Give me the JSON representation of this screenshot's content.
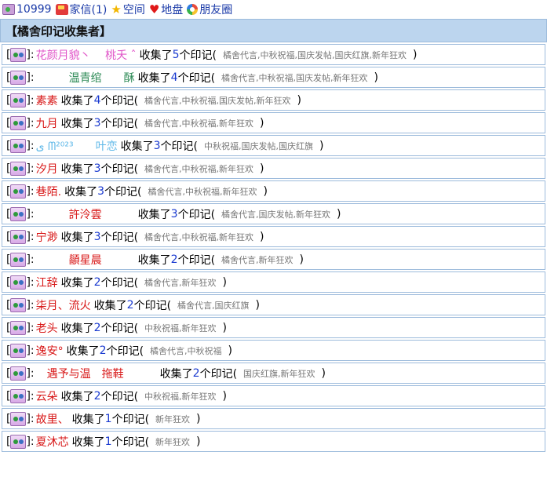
{
  "topbar": {
    "items": [
      {
        "label": "10999",
        "icon": "badge-icon"
      },
      {
        "label": "家信(1)",
        "icon": "mail-icon"
      },
      {
        "label": "空间",
        "icon": "star-icon"
      },
      {
        "label": "地盘",
        "icon": "heart-icon"
      },
      {
        "label": "朋友圈",
        "icon": "ring-icon"
      }
    ]
  },
  "panel": {
    "title": "【橘舍印记收集者】",
    "collected_prefix": "收集了",
    "collected_suffix": "个印记(",
    "close_paren": ")",
    "rows": [
      {
        "name": "花颜月貌丶 　桃夭 ˆ",
        "name_color": "#e055c8",
        "count": "5",
        "tags": "橘舍代言,中秋祝福,国庆发帖,国庆红旗,新年狂欢"
      },
      {
        "name": "　　　温青绾　　酥",
        "name_color": "#2e8b57",
        "count": "4",
        "tags": "橘舍代言,中秋祝福,国庆发帖,新年狂欢"
      },
      {
        "name": "素素",
        "name_color": "#d81818",
        "count": "4",
        "tags": "橘舍代言,中秋祝福,国庆发帖,新年狂欢"
      },
      {
        "name": "九月",
        "name_color": "#d81818",
        "count": "3",
        "tags": "橘舍代言,中秋祝福,新年狂欢"
      },
      {
        "name": "ى ᗰ²⁰²³　　叶恋",
        "name_color": "#5fb8e8",
        "count": "3",
        "tags": "中秋祝福,国庆发帖,国庆红旗"
      },
      {
        "name": "汐月",
        "name_color": "#d81818",
        "count": "3",
        "tags": "橘舍代言,中秋祝福,新年狂欢"
      },
      {
        "name": "巷陌.",
        "name_color": "#d81818",
        "count": "3",
        "tags": "橘舍代言,中秋祝福,新年狂欢"
      },
      {
        "name": "　　　許泠雲　　　",
        "name_color": "#d81818",
        "count": "3",
        "tags": "橘舍代言,国庆发帖,新年狂欢"
      },
      {
        "name": "宁渺",
        "name_color": "#d81818",
        "count": "3",
        "tags": "橘舍代言,中秋祝福,新年狂欢"
      },
      {
        "name": "　　　顲星晨　　　",
        "name_color": "#d81818",
        "count": "2",
        "tags": "橘舍代言,新年狂欢"
      },
      {
        "name": "江辞",
        "name_color": "#d81818",
        "count": "2",
        "tags": "橘舍代言,新年狂欢"
      },
      {
        "name": " 柒月、流火",
        "name_color": "#d81818",
        "count": "2",
        "tags": "橘舍代言,国庆红旗"
      },
      {
        "name": "老头",
        "name_color": "#d81818",
        "count": "2",
        "tags": "中秋祝福,新年狂欢"
      },
      {
        "name": "逸安°",
        "name_color": "#d81818",
        "count": "2",
        "tags": "橘舍代言,中秋祝福"
      },
      {
        "name": " 　遇予与温　拖鞋　　　",
        "name_color": "#d81818",
        "count": "2",
        "tags": "国庆红旗,新年狂欢"
      },
      {
        "name": " 云朵",
        "name_color": "#d81818",
        "count": "2",
        "tags": "中秋祝福,新年狂欢"
      },
      {
        "name": "故里、 ",
        "name_color": "#d81818",
        "count": "1",
        "tags": "新年狂欢"
      },
      {
        "name": "夏沐芯",
        "name_color": "#d81818",
        "count": "1",
        "tags": "新年狂欢"
      }
    ]
  }
}
